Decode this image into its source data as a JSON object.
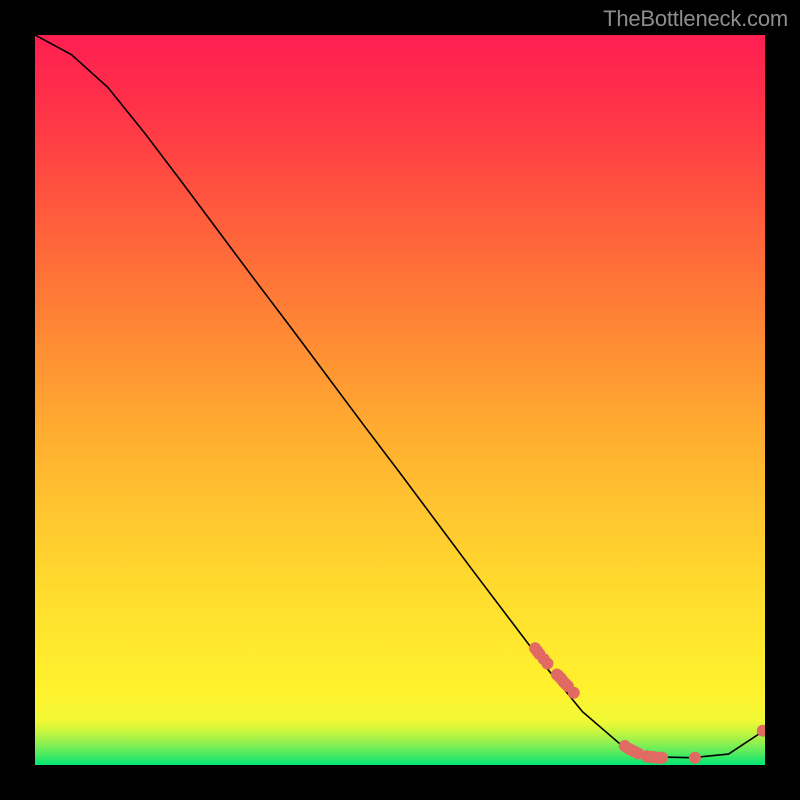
{
  "credit": "TheBottleneck.com",
  "colors": {
    "curve": "#000000",
    "marker": "#e16a63"
  },
  "chart_data": {
    "type": "line",
    "title": "",
    "xlabel": "",
    "ylabel": "",
    "xlim": [
      0,
      100
    ],
    "ylim": [
      0,
      100
    ],
    "grid": false,
    "legend": false,
    "series": [
      {
        "name": "curve",
        "x": [
          0,
          5,
          10,
          15,
          20,
          25,
          30,
          35,
          40,
          45,
          50,
          55,
          60,
          65,
          70,
          75,
          80,
          85,
          90,
          95,
          100
        ],
        "y": [
          100.0,
          97.3,
          92.8,
          86.6,
          80.0,
          73.3,
          66.6,
          60.0,
          53.3,
          46.6,
          40.0,
          33.3,
          26.6,
          20.0,
          13.4,
          7.3,
          3.0,
          1.1,
          1.0,
          1.5,
          4.8
        ]
      }
    ],
    "markers": {
      "name": "marker",
      "x": [
        68.5,
        68.8,
        69.1,
        69.7,
        70.2,
        71.5,
        71.8,
        72.1,
        72.4,
        72.7,
        73.0,
        73.8,
        80.8,
        81.4,
        82.0,
        82.6,
        83.8,
        84.2,
        84.5,
        84.8,
        85.1,
        85.6,
        85.9,
        90.4,
        99.7
      ],
      "y": [
        16.0,
        15.6,
        15.2,
        14.5,
        13.9,
        12.4,
        12.1,
        11.8,
        11.4,
        11.1,
        10.8,
        9.9,
        2.6,
        2.2,
        1.9,
        1.6,
        1.2,
        1.1,
        1.1,
        1.1,
        1.0,
        1.0,
        1.0,
        1.0,
        4.7
      ]
    }
  }
}
